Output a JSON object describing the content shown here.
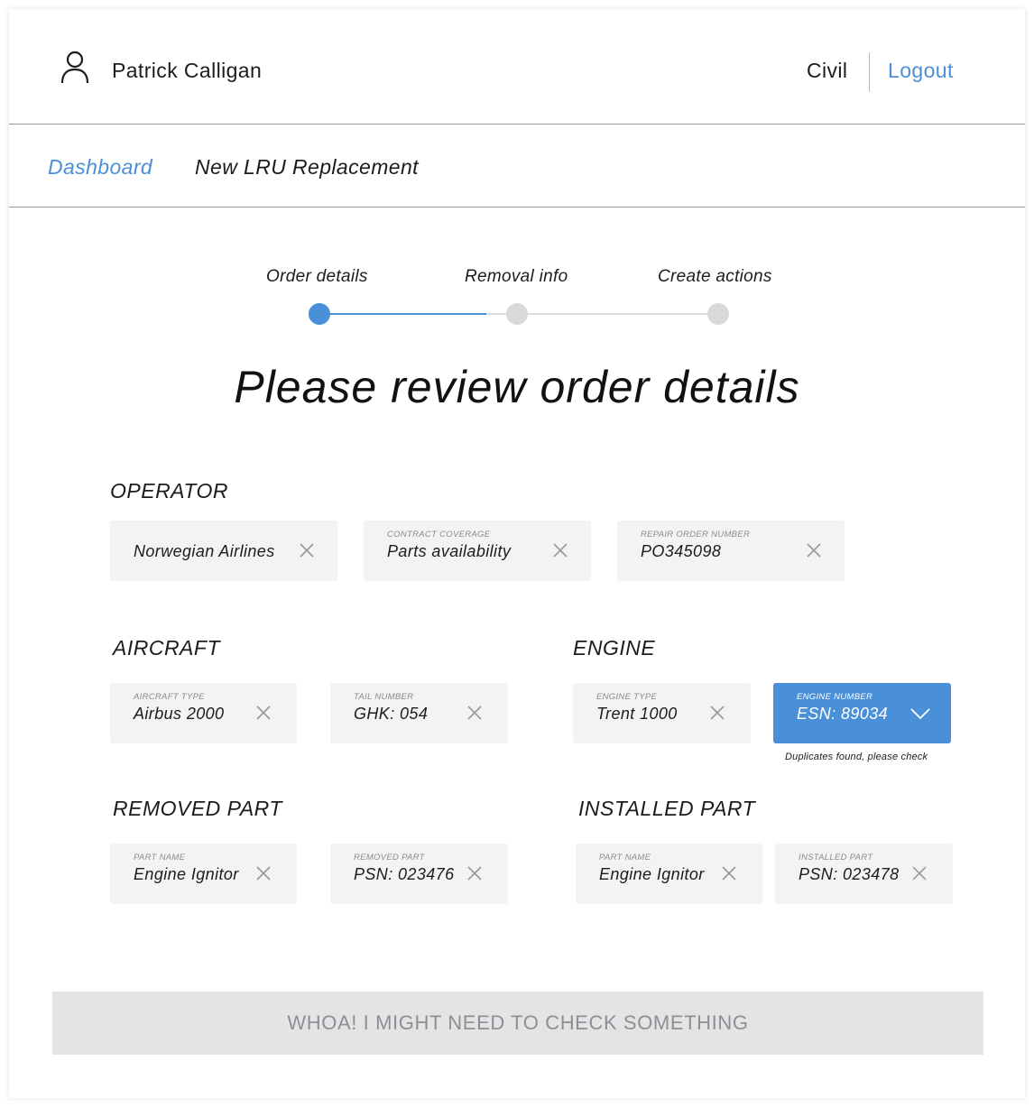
{
  "header": {
    "user_name": "Patrick Calligan",
    "mode": "Civil",
    "logout_label": "Logout",
    "icons": {
      "user": "user-icon"
    }
  },
  "nav": {
    "dashboard_label": "Dashboard",
    "current_page": "New LRU Replacement"
  },
  "stepper": {
    "steps": [
      {
        "label": "Order details",
        "state": "active"
      },
      {
        "label": "Removal info",
        "state": "pending"
      },
      {
        "label": "Create actions",
        "state": "pending"
      }
    ],
    "colors": {
      "active": "#4a90d9",
      "pending": "#d9d9d9"
    }
  },
  "title": "Please review order details",
  "operator": {
    "title": "OPERATOR",
    "fields": [
      {
        "label": "",
        "value": "Norwegian Airlines"
      },
      {
        "label": "CONTRACT COVERAGE",
        "value": "Parts availability"
      },
      {
        "label": "REPAIR ORDER NUMBER",
        "value": "PO345098"
      }
    ]
  },
  "aircraft": {
    "title": "AIRCRAFT",
    "fields": [
      {
        "label": "AIRCRAFT TYPE",
        "value": "Airbus 2000"
      },
      {
        "label": "TAIL NUMBER",
        "value": "GHK: 054"
      }
    ]
  },
  "engine": {
    "title": "ENGINE",
    "fields": [
      {
        "label": "ENGINE TYPE",
        "value": "Trent 1000"
      },
      {
        "label": "ENGINE NUMBER",
        "value": "ESN: 89034",
        "warning": "Duplicates found, please check"
      }
    ]
  },
  "removed_part": {
    "title": "REMOVED PART",
    "fields": [
      {
        "label": "PART NAME",
        "value": "Engine Ignitor"
      },
      {
        "label": "REMOVED PART",
        "value": "PSN: 023476"
      }
    ]
  },
  "installed_part": {
    "title": "INSTALLED PART",
    "fields": [
      {
        "label": "PART NAME",
        "value": "Engine Ignitor"
      },
      {
        "label": "INSTALLED PART",
        "value": "PSN: 023478"
      }
    ]
  },
  "cta_label": "WHOA! I MIGHT NEED TO CHECK SOMETHING",
  "colors": {
    "accent": "#4a90d9",
    "field_bg": "#f3f3f4",
    "cta_bg": "#e4e4e6"
  }
}
